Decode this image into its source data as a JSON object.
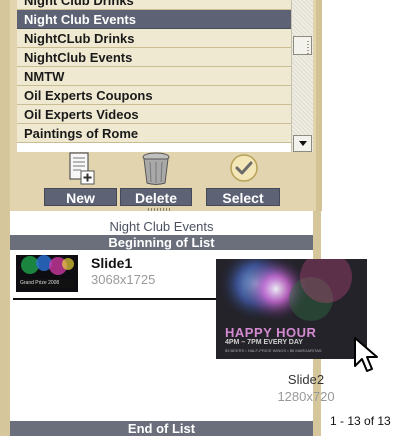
{
  "list": {
    "items": [
      {
        "label": "Night Club Drinks"
      },
      {
        "label": "Night Club Events",
        "selected": true
      },
      {
        "label": "NightCLub Drinks"
      },
      {
        "label": "NightClub Events"
      },
      {
        "label": "NMTW"
      },
      {
        "label": "Oil Experts Coupons"
      },
      {
        "label": "Oil Experts Videos"
      },
      {
        "label": "Paintings of Rome"
      }
    ]
  },
  "actions": {
    "new_label": "New",
    "delete_label": "Delete",
    "select_label": "Select"
  },
  "slides": {
    "group_title": "Night Club Events",
    "begin_label": "Beginning of List",
    "end_label": "End of List",
    "items": [
      {
        "name": "Slide1",
        "size": "3068x1725",
        "thumb_text": "Grand Prize 2008"
      },
      {
        "name": "Slide2",
        "size": "1280x720",
        "thumb_title": "HAPPY HOUR",
        "thumb_subtitle": "4PM – 7PM EVERY DAY",
        "thumb_fine": "$3 BEERS • HALF-PRICE WINGS • $5 MARGARITAS"
      }
    ],
    "pager": "1 - 13 of 13"
  },
  "colors": {
    "panel": "#e2d4ae",
    "button": "#5d6274",
    "bar": "#6b6f7c",
    "happy_hour": "#d48ad0"
  },
  "icons": [
    "new-document-icon",
    "trash-can-icon",
    "checkmark-icon",
    "pointer-cursor-icon"
  ]
}
